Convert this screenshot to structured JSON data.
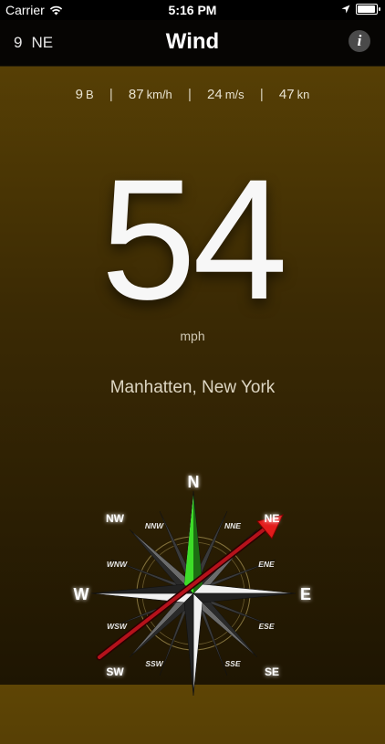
{
  "status_bar": {
    "carrier": "Carrier",
    "time": "5:16 PM",
    "battery_level": 1.0
  },
  "nav": {
    "wind_summary_speed": "9",
    "wind_summary_dir": "NE",
    "title": "Wind",
    "info_icon": "i"
  },
  "units": {
    "beaufort_value": "9",
    "beaufort_unit": "B",
    "kmh_value": "87",
    "kmh_unit": "km/h",
    "ms_value": "24",
    "ms_unit": "m/s",
    "kn_value": "47",
    "kn_unit": "kn",
    "separator": "|"
  },
  "speed": {
    "value": "54",
    "unit": "mph"
  },
  "location": "Manhatten, New York",
  "compass": {
    "cardinal": {
      "n": "N",
      "e": "E",
      "w": "W"
    },
    "intercardinal": {
      "ne": "NE",
      "nw": "NW",
      "se": "SE",
      "sw": "SW"
    },
    "minor": {
      "nne": "NNE",
      "nnw": "NNW",
      "ene": "ENE",
      "wnw": "WNW",
      "ese": "ESE",
      "wsw": "WSW",
      "sse": "SSE",
      "ssw": "SSW"
    },
    "wind_direction": "NE",
    "colors": {
      "north_needle": "#3ddc28",
      "arrow": "#e21b1b",
      "ring": "#9c8a4c"
    }
  },
  "icons": [
    "wifi-icon",
    "location-arrow-icon",
    "battery-icon",
    "info-icon"
  ]
}
